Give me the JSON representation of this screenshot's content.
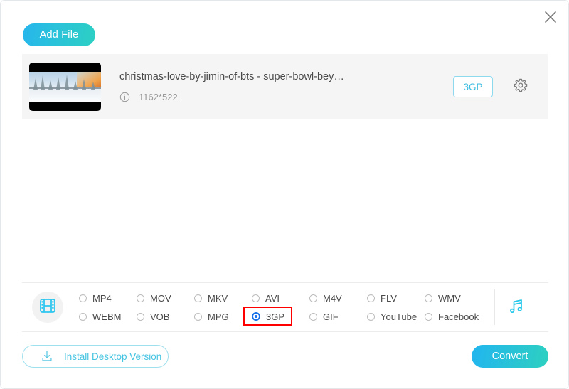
{
  "window": {
    "close_label": "close-icon"
  },
  "toolbar": {
    "add_file_label": "Add File"
  },
  "file": {
    "name": "christmas-love-by-jimin-of-bts - super-bowl-bey…",
    "dimensions": "1162*522",
    "format_badge": "3GP",
    "info_icon": "info-circle-icon",
    "settings_icon": "gear-icon",
    "thumbnail": "video-thumbnail"
  },
  "format_picker": {
    "video_icon": "film-strip-icon",
    "audio_icon": "music-note-icon",
    "selected": "3GP",
    "options": [
      {
        "label": "MP4",
        "selected": false
      },
      {
        "label": "MOV",
        "selected": false
      },
      {
        "label": "MKV",
        "selected": false
      },
      {
        "label": "AVI",
        "selected": false
      },
      {
        "label": "M4V",
        "selected": false
      },
      {
        "label": "FLV",
        "selected": false
      },
      {
        "label": "WMV",
        "selected": false
      },
      {
        "label": "WEBM",
        "selected": false
      },
      {
        "label": "VOB",
        "selected": false
      },
      {
        "label": "MPG",
        "selected": false
      },
      {
        "label": "3GP",
        "selected": true
      },
      {
        "label": "GIF",
        "selected": false
      },
      {
        "label": "YouTube",
        "selected": false
      },
      {
        "label": "Facebook",
        "selected": false
      }
    ]
  },
  "footer": {
    "install_label": "Install Desktop Version",
    "install_icon": "download-icon",
    "convert_label": "Convert"
  },
  "colors": {
    "accent_cyan": "#2ab8e8",
    "accent_teal": "#2ed0c0",
    "annotation_red": "#ff0000",
    "radio_selected_blue": "#1a73e8",
    "row_background": "#f5f5f5"
  }
}
